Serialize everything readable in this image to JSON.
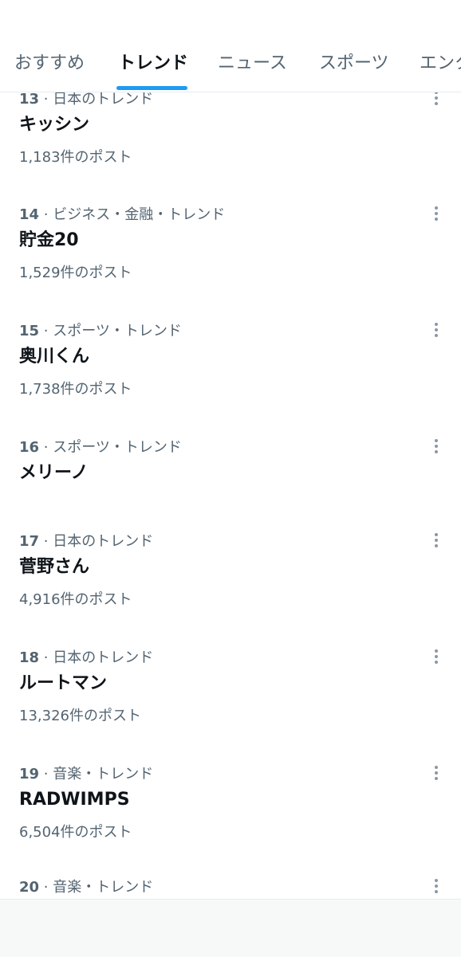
{
  "tabs": [
    {
      "label": "おすすめ",
      "active": false
    },
    {
      "label": "トレンド",
      "active": true
    },
    {
      "label": "ニュース",
      "active": false
    },
    {
      "label": "スポーツ",
      "active": false
    },
    {
      "label": "エンタ",
      "active": false
    }
  ],
  "trends": [
    {
      "rank": "13",
      "category": "日本のトレンド",
      "title": "キッシン",
      "count": "1,183件のポスト"
    },
    {
      "rank": "14",
      "category": "ビジネス・金融・トレンド",
      "title": "貯金20",
      "count": "1,529件のポスト"
    },
    {
      "rank": "15",
      "category": "スポーツ・トレンド",
      "title": "奥川くん",
      "count": "1,738件のポスト"
    },
    {
      "rank": "16",
      "category": "スポーツ・トレンド",
      "title": "メリーノ",
      "count": ""
    },
    {
      "rank": "17",
      "category": "日本のトレンド",
      "title": "菅野さん",
      "count": "4,916件のポスト"
    },
    {
      "rank": "18",
      "category": "日本のトレンド",
      "title": "ルートマン",
      "count": "13,326件のポスト"
    },
    {
      "rank": "19",
      "category": "音楽・トレンド",
      "title": "RADWIMPS",
      "count": "6,504件のポスト"
    },
    {
      "rank": "20",
      "category": "音楽・トレンド",
      "title": "",
      "count": ""
    }
  ],
  "theme": {
    "accent": "#1d9bf0",
    "primary_text": "#0f1419",
    "secondary_text": "#536471",
    "divider": "#e6ecf0"
  }
}
